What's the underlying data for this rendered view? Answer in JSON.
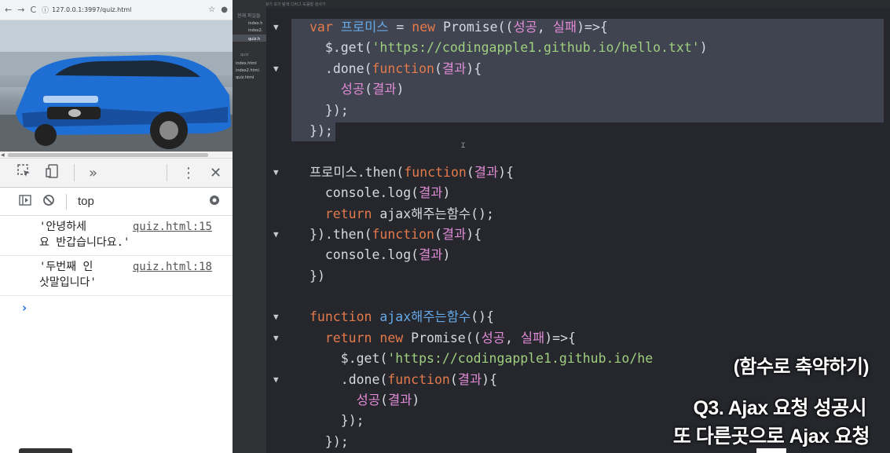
{
  "browser": {
    "url": "127.0.0.1:3997/quiz.html",
    "nav": {
      "back": "←",
      "forward": "→",
      "reload": "C"
    },
    "info": "ⓘ",
    "star": "☆",
    "profile": "●"
  },
  "devtools": {
    "inspect_icon": "inspect-element-icon",
    "device_icon": "device-toolbar-icon",
    "more_tabs": "»",
    "menu": "⋮",
    "close": "✕",
    "context": "top"
  },
  "console": {
    "logs": [
      {
        "text_line1": "'안녕하세",
        "text_line2": "요 반갑습니다요.'",
        "source": "quiz.html:15"
      },
      {
        "text_line1": "'두번째 인",
        "text_line2": "삿말입니다'",
        "source": "quiz.html:18"
      }
    ],
    "prompt": "›"
  },
  "sidebar": {
    "header": "현재 파일들",
    "open_files": [
      "index.h",
      "index2.",
      "quiz.h"
    ],
    "group": "quiz",
    "project_files": [
      "index.html",
      "index2.html",
      "quiz.html"
    ]
  },
  "topstrip": "파일  편집  찾기  보기  탐색  디버그  도움말  검사기",
  "code_lines": [
    "var 프로미스 = new Promise((성공, 실패)=>{",
    "  $.get('https://codingapple1.github.io/hello.txt')",
    "  .done(function(결과){",
    "    성공(결과)",
    "  });",
    "});",
    "",
    "프로미스.then(function(결과){",
    "  console.log(결과)",
    "  return ajax해주는함수();",
    "}).then(function(결과){",
    "  console.log(결과)",
    "})",
    "",
    "function ajax해주는함수(){",
    "  return new Promise((성공, 실패)=>{",
    "    $.get('https://codingapple1.github.io/he",
    "    .done(function(결과){",
    "      성공(결과)",
    "    });",
    "  });"
  ],
  "captions": {
    "c1": "(함수로 축약하기)",
    "c2": "Q3. Ajax 요청 성공시",
    "c3": "또 다른곳으로 Ajax 요청"
  },
  "colors": {
    "keyword": "#e57a4b",
    "string": "#9fcf7f",
    "param": "#e18bd6",
    "function_name": "#66a9e8",
    "editor_bg": "#25272c",
    "selection": "#3f4450"
  }
}
